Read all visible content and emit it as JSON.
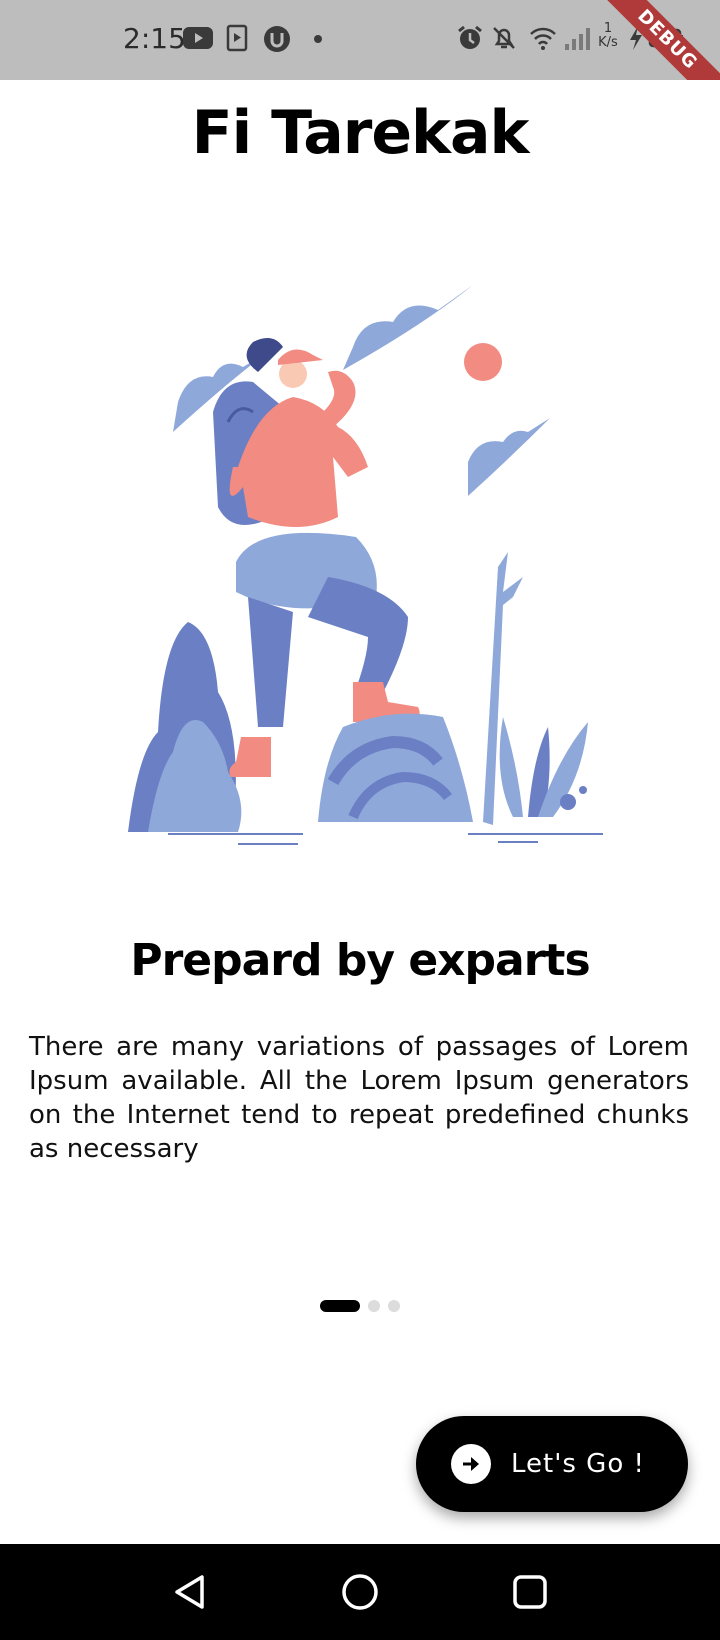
{
  "status_bar": {
    "time": "2:15",
    "speed_value": "1",
    "speed_unit": "K/s",
    "icons": [
      "youtube-icon",
      "media-icon",
      "shield-icon",
      "notification-dot-icon",
      "alarm-icon",
      "bell-off-icon",
      "wifi-icon",
      "signal-icon",
      "charging-icon",
      "battery-icon"
    ],
    "debug_label": "DEBUG"
  },
  "app": {
    "title": "Fi Tarekak"
  },
  "onboarding": {
    "heading": "Prepard by exparts",
    "body": "There are many variations of passages of Lorem Ipsum available. All the Lorem Ipsum generators on the Internet tend to repeat predefined chunks as necessary",
    "page_count": 3,
    "current_page": 1
  },
  "cta": {
    "label": "Let's Go !",
    "icon": "arrow-right-icon"
  },
  "nav": {
    "buttons": [
      "back-icon",
      "home-icon",
      "recents-icon"
    ]
  },
  "colors": {
    "accent": "#000000",
    "illustration_coral": "#F28B82",
    "illustration_blue": "#8FA8DA",
    "illustration_navy": "#6A7FC4",
    "status_bar": "#BDBDBD",
    "debug_ribbon": "#B03A3A"
  }
}
